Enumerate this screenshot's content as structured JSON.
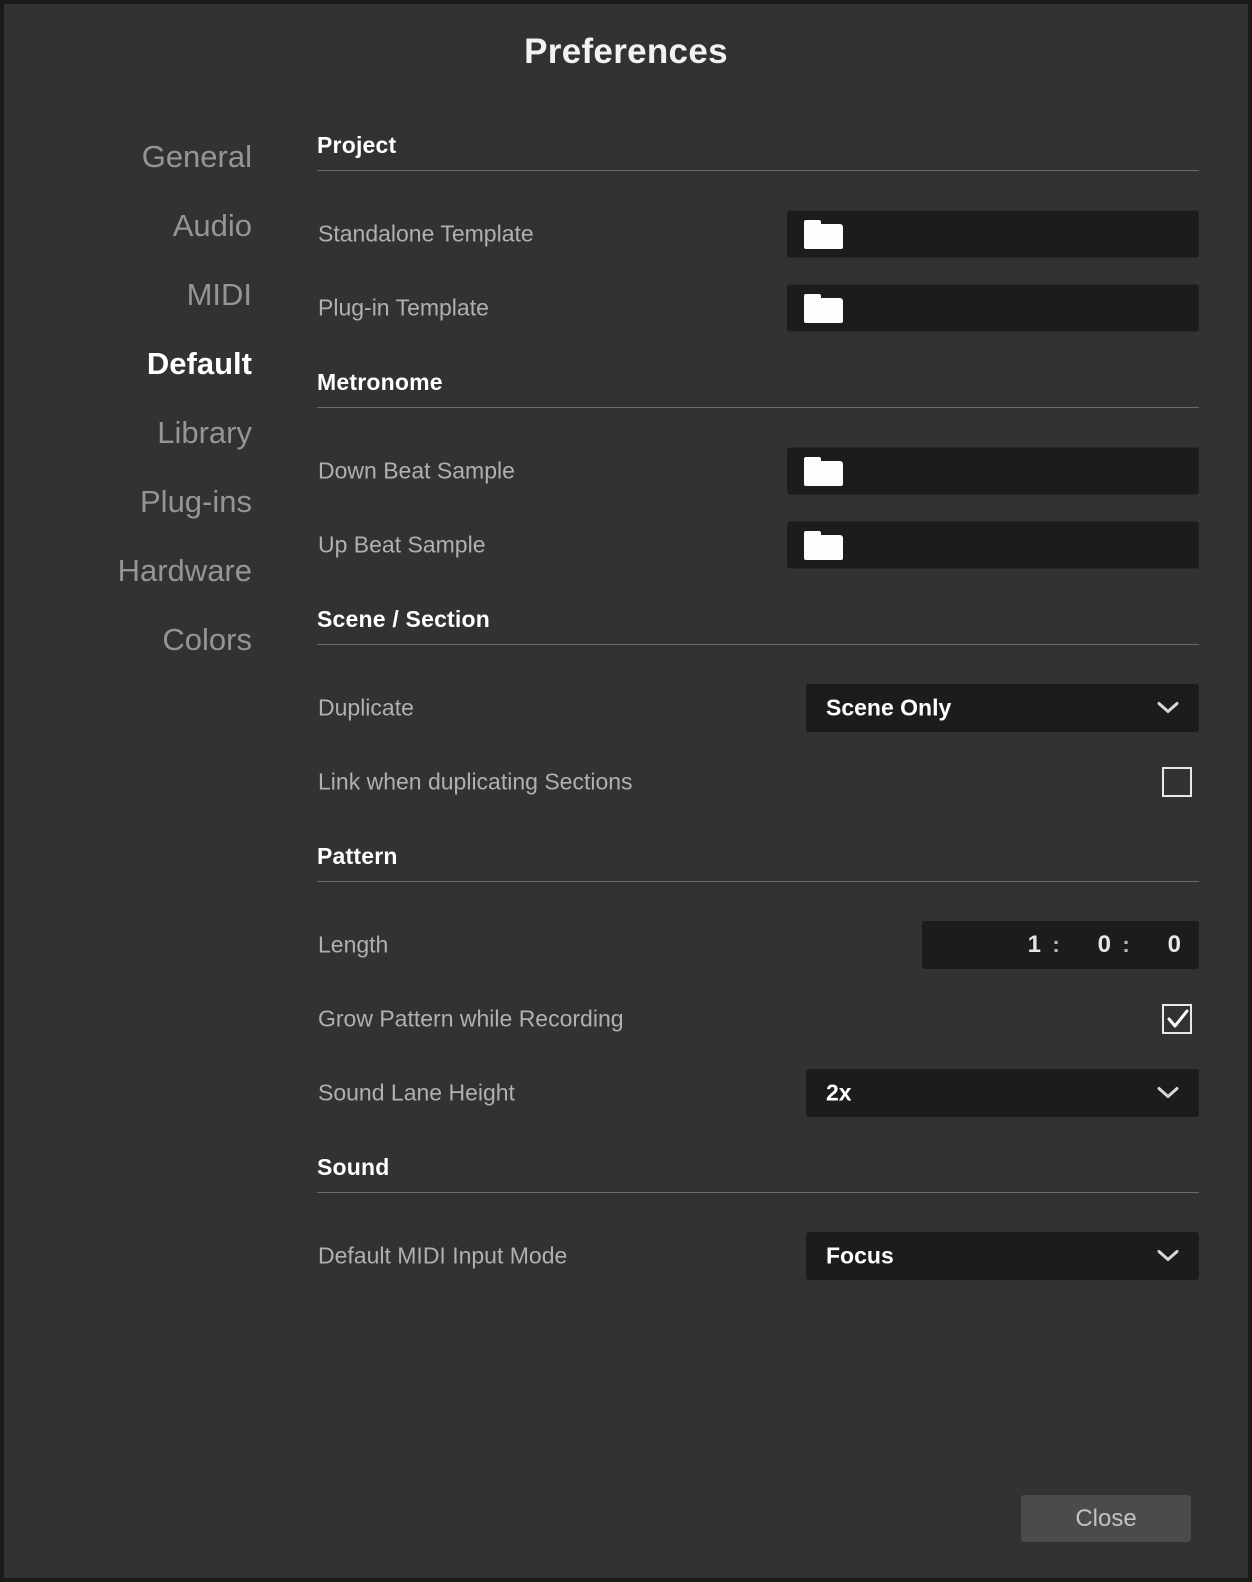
{
  "dialog": {
    "title": "Preferences"
  },
  "sidebar": {
    "items": [
      {
        "label": "General",
        "active": false
      },
      {
        "label": "Audio",
        "active": false
      },
      {
        "label": "MIDI",
        "active": false
      },
      {
        "label": "Default",
        "active": true
      },
      {
        "label": "Library",
        "active": false
      },
      {
        "label": "Plug-ins",
        "active": false
      },
      {
        "label": "Hardware",
        "active": false
      },
      {
        "label": "Colors",
        "active": false
      }
    ]
  },
  "sections": {
    "project": {
      "heading": "Project",
      "standalone_template_label": "Standalone Template",
      "standalone_template_value": "",
      "plugin_template_label": "Plug-in Template",
      "plugin_template_value": ""
    },
    "metronome": {
      "heading": "Metronome",
      "down_beat_label": "Down Beat Sample",
      "down_beat_value": "",
      "up_beat_label": "Up Beat Sample",
      "up_beat_value": ""
    },
    "scene_section": {
      "heading": "Scene / Section",
      "duplicate_label": "Duplicate",
      "duplicate_value": "Scene Only",
      "link_label": "Link when duplicating Sections",
      "link_checked": false
    },
    "pattern": {
      "heading": "Pattern",
      "length_label": "Length",
      "length_bars": "1",
      "length_beats": "0",
      "length_ticks": "0",
      "length_sep": ":",
      "grow_label": "Grow Pattern while Recording",
      "grow_checked": true,
      "lane_height_label": "Sound Lane Height",
      "lane_height_value": "2x"
    },
    "sound": {
      "heading": "Sound",
      "midi_input_label": "Default MIDI Input Mode",
      "midi_input_value": "Focus"
    }
  },
  "footer": {
    "close_label": "Close"
  },
  "icons": {
    "folder": "folder-icon",
    "chevron": "chevron-down-icon",
    "check": "check-icon"
  },
  "colors": {
    "dialog_bg": "#323232",
    "field_bg": "#1c1c1c",
    "label": "#b0b0b0",
    "heading": "#ffffff",
    "sidebar_inactive": "#959595",
    "sidebar_active": "#ffffff",
    "button_bg": "#4b4b4b",
    "rule": "#6a6a6a"
  }
}
